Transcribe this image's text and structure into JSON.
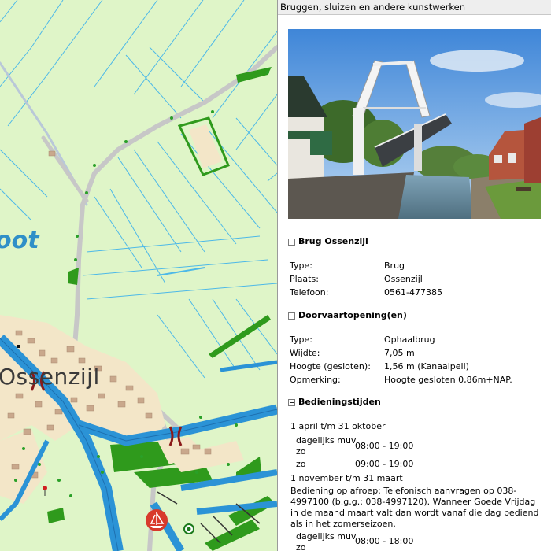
{
  "map": {
    "labels": {
      "water": "oot",
      "town": "Ossenzijl"
    },
    "icons": [
      "bridge-symbol-icon",
      "marina-icon",
      "buoy-icon",
      "location-pin-icon"
    ]
  },
  "panel": {
    "title": "Bruggen, sluizen en andere kunstwerken",
    "sections": [
      {
        "title": "Brug Ossenzijl",
        "rows": [
          {
            "key": "Type:",
            "value": "Brug"
          },
          {
            "key": "Plaats:",
            "value": "Ossenzijl"
          },
          {
            "key": "Telefoon:",
            "value": "0561-477385"
          }
        ]
      },
      {
        "title": "Doorvaartopening(en)",
        "rows": [
          {
            "key": "Type:",
            "value": "Ophaalbrug"
          },
          {
            "key": "Wijdte:",
            "value": "7,05 m"
          },
          {
            "key": "Hoogte (gesloten):",
            "value": "1,56 m (Kanaalpeil)"
          },
          {
            "key": "Opmerking:",
            "value": "Hoogte gesloten 0,86m+NAP."
          }
        ]
      },
      {
        "title": "Bedieningstijden",
        "period1": "1 april t/m 31 oktober",
        "daily1_line1": "dagelijks muv",
        "daily1_line2": "zo",
        "daily1_time": "08:00 - 19:00",
        "sun1_label": "zo",
        "sun1_time": "09:00 - 19:00",
        "period2": "1 november t/m 31 maart",
        "note": "Bediening op afroep: Telefonisch aanvragen op 038-4997100 (b.g.g.: 038-4997120). Wanneer Goede Vrijdag in de maand maart valt dan wordt vanaf die dag bediend als in het zomerseizoen.",
        "daily2_line1": "dagelijks muv",
        "daily2_line2": "zo",
        "daily2_time": "08:00 - 18:00"
      }
    ]
  },
  "colors": {
    "land": "#dff5c8",
    "water": "#2b93d6",
    "ditch": "#4cb8e8",
    "green": "#2f9a1c",
    "road": "#c7c7c7",
    "built": "#f3e6c8"
  }
}
